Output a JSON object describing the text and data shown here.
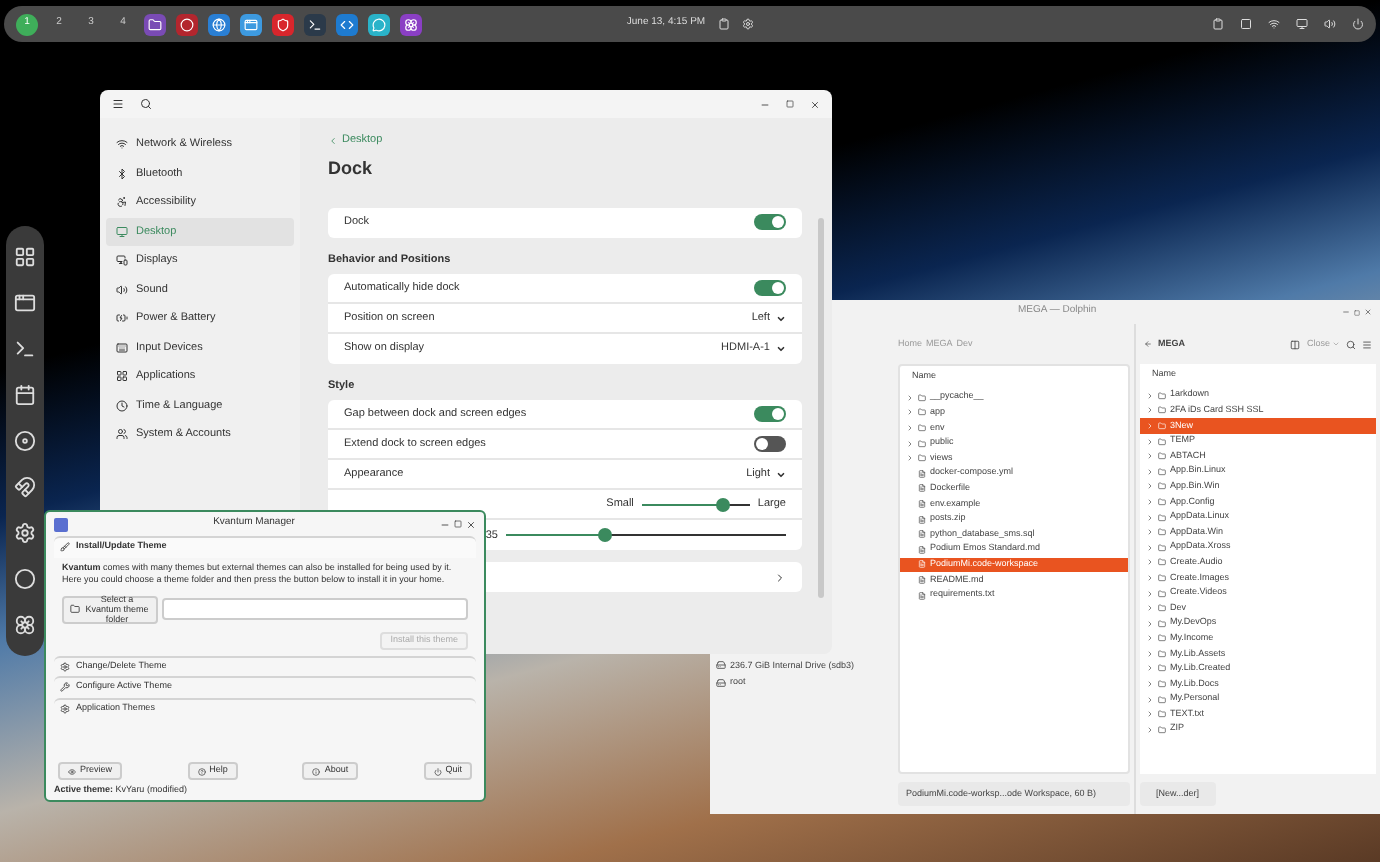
{
  "top_bar": {
    "workspaces": [
      {
        "label": "1",
        "selected": true
      },
      {
        "label": "2",
        "selected": false
      },
      {
        "label": "3",
        "selected": false
      },
      {
        "label": "4",
        "selected": false
      }
    ],
    "clock": "June 13, 4:15 PM"
  },
  "settings_window": {
    "sidebar": [
      {
        "label": "Network & Wireless",
        "selected": false
      },
      {
        "label": "Bluetooth",
        "selected": false
      },
      {
        "label": "Accessibility",
        "selected": false
      },
      {
        "label": "Desktop",
        "selected": true
      },
      {
        "label": "Displays",
        "selected": false
      },
      {
        "label": "Sound",
        "selected": false
      },
      {
        "label": "Power & Battery",
        "selected": false
      },
      {
        "label": "Input Devices",
        "selected": false
      },
      {
        "label": "Applications",
        "selected": false
      },
      {
        "label": "Time & Language",
        "selected": false
      },
      {
        "label": "System & Accounts",
        "selected": false
      }
    ],
    "back_link": "Desktop",
    "title": "Dock",
    "sections": [
      {
        "rows": [
          {
            "kind": "toggle",
            "label": "Dock",
            "on": true
          }
        ]
      },
      {
        "heading": "Behavior and Positions",
        "rows": [
          {
            "kind": "toggle",
            "label": "Automatically hide dock",
            "on": true
          },
          {
            "kind": "dropdown",
            "label": "Position on screen",
            "value": "Left"
          },
          {
            "kind": "dropdown",
            "label": "Show on display",
            "value": "HDMI-A-1"
          }
        ]
      },
      {
        "heading": "Style",
        "rows": [
          {
            "kind": "toggle",
            "label": "Gap between dock and screen edges",
            "on": true
          },
          {
            "kind": "toggle",
            "label": "Extend dock to screen edges",
            "on": false
          },
          {
            "kind": "dropdown",
            "label": "Appearance",
            "value": "Light"
          },
          {
            "kind": "slider",
            "min_label": "Small",
            "max_label": "Large",
            "level": 0.75
          },
          {
            "kind": "slider",
            "min_label": "35",
            "level": 0.35
          }
        ]
      },
      {
        "rows": [
          {
            "kind": "link"
          }
        ]
      }
    ]
  },
  "dolphin_window": {
    "title": "MEGA — Dolphin",
    "places": [
      {
        "label": "236.7 GiB Internal Drive (sdb3)"
      },
      {
        "label": "root"
      }
    ],
    "left_pane": {
      "breadcrumb": [
        "Home",
        "MEGA",
        "Dev"
      ],
      "column": "Name",
      "items": [
        {
          "name": "__pycache__",
          "kind": "folder",
          "selected": false
        },
        {
          "name": "app",
          "kind": "folder",
          "selected": false
        },
        {
          "name": "env",
          "kind": "folder",
          "selected": false
        },
        {
          "name": "public",
          "kind": "folder",
          "selected": false
        },
        {
          "name": "views",
          "kind": "folder",
          "selected": false
        },
        {
          "name": "docker-compose.yml",
          "kind": "file",
          "selected": false
        },
        {
          "name": "Dockerfile",
          "kind": "file",
          "selected": false
        },
        {
          "name": "env.example",
          "kind": "file",
          "selected": false
        },
        {
          "name": "posts.zip",
          "kind": "file",
          "selected": false
        },
        {
          "name": "python_database_sms.sql",
          "kind": "file",
          "selected": false
        },
        {
          "name": "Podium Emos Standard.md",
          "kind": "file",
          "selected": false
        },
        {
          "name": "PodiumMi.code-workspace",
          "kind": "file",
          "selected": true
        },
        {
          "name": "README.md",
          "kind": "file",
          "selected": false
        },
        {
          "name": "requirements.txt",
          "kind": "file",
          "selected": false
        }
      ],
      "status": "PodiumMi.code-worksp...ode Workspace, 60 B)"
    },
    "right_pane": {
      "location": "MEGA",
      "close_button": "Close",
      "column": "Name",
      "items": [
        {
          "name": "1arkdown",
          "selected": false
        },
        {
          "name": "2FA iDs Card SSH SSL",
          "selected": false
        },
        {
          "name": "3New",
          "selected": true
        },
        {
          "name": "TEMP",
          "selected": false
        },
        {
          "name": "ABTACH",
          "selected": false
        },
        {
          "name": "App.Bin.Linux",
          "selected": false
        },
        {
          "name": "App.Bin.Win",
          "selected": false
        },
        {
          "name": "App.Config",
          "selected": false
        },
        {
          "name": "AppData.Linux",
          "selected": false
        },
        {
          "name": "AppData.Win",
          "selected": false
        },
        {
          "name": "AppData.Xross",
          "selected": false
        },
        {
          "name": "Create.Audio",
          "selected": false
        },
        {
          "name": "Create.Images",
          "selected": false
        },
        {
          "name": "Create.Videos",
          "selected": false
        },
        {
          "name": "Dev",
          "selected": false
        },
        {
          "name": "My.DevOps",
          "selected": false
        },
        {
          "name": "My.Income",
          "selected": false
        },
        {
          "name": "My.Lib.Assets",
          "selected": false
        },
        {
          "name": "My.Lib.Created",
          "selected": false
        },
        {
          "name": "My.Lib.Docs",
          "selected": false
        },
        {
          "name": "My.Personal",
          "selected": false
        },
        {
          "name": "TEXT.txt",
          "selected": false
        },
        {
          "name": "ZIP",
          "selected": false
        }
      ],
      "status": "[New...der]"
    }
  },
  "kvantum_window": {
    "title": "Kvantum Manager",
    "sections": [
      {
        "label": "Install/Update Theme",
        "expanded": true
      },
      {
        "label": "Change/Delete Theme",
        "expanded": false
      },
      {
        "label": "Configure Active Theme",
        "expanded": false
      },
      {
        "label": "Application Themes",
        "expanded": false
      }
    ],
    "intro": "**Kvantum** comes with many themes but external themes can also be installed for being used by it. Here you could choose a theme folder and then press the button below to install it in your home.",
    "folder_button": "Select a Kvantum theme folder",
    "install_button": {
      "label": "Install this theme",
      "disabled": true
    },
    "buttons": [
      "Preview",
      "Help",
      "About",
      "Quit"
    ],
    "status": "**Active theme:** KvYaru (modified)"
  }
}
